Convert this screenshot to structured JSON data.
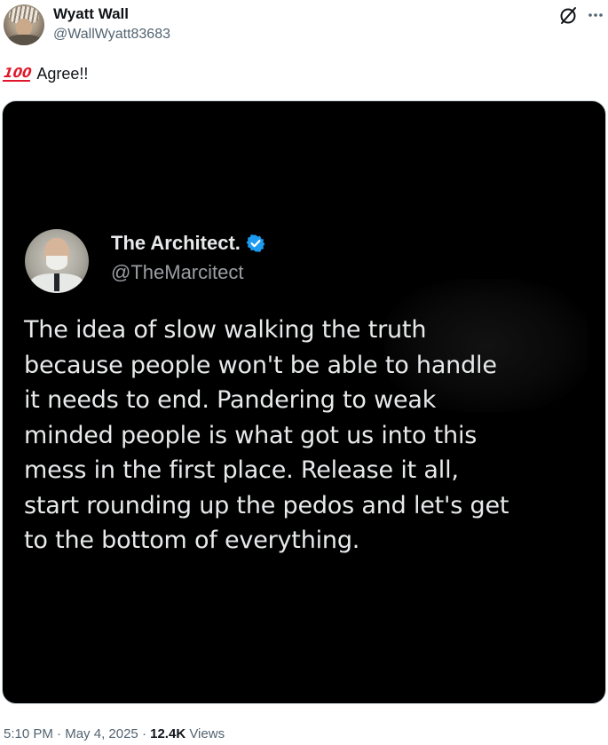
{
  "author": {
    "display_name": "Wyatt Wall",
    "handle": "@WallWyatt83683"
  },
  "post": {
    "emoji_icon": "hundred-points-icon",
    "text": "Agree!!"
  },
  "quoted_image": {
    "author_name": "The Architect.",
    "author_handle": "@TheMarcitect",
    "verified_color": "#1d9bf0",
    "lines": [
      "The idea of slow walking the truth",
      "because people won't be able to handle",
      "it needs to end. Pandering to weak",
      "minded people is what got us into this",
      "mess in the first place. Release it all,",
      "start rounding up the pedos and let's get",
      "to the bottom of everything."
    ]
  },
  "footer": {
    "time": "5:10 PM",
    "separator": "·",
    "date": "May 4, 2025",
    "views_count": "12.4K",
    "views_label": "Views"
  },
  "icons": {
    "grok": "grok-icon",
    "more": "more-icon",
    "verified": "verified-badge-icon"
  },
  "colors": {
    "text_primary": "#0f1419",
    "text_secondary": "#536471",
    "media_background": "#000000",
    "emoji_red": "#e1182b"
  }
}
